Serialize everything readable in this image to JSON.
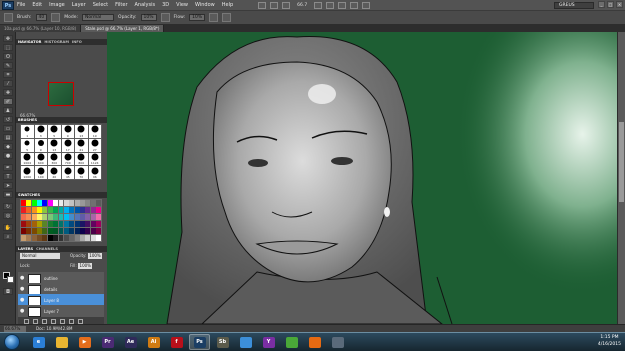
{
  "app": {
    "logo_text": "Ps"
  },
  "menu": {
    "items": [
      "File",
      "Edit",
      "Image",
      "Layer",
      "Select",
      "Filter",
      "Analysis",
      "3D",
      "View",
      "Window",
      "Help"
    ],
    "zoom_readout": "66.7",
    "workspace_label": "GREUS"
  },
  "options_bar": {
    "brush_label": "Brush:",
    "brush_size": "40",
    "mode_label": "Mode:",
    "mode_value": "Normal",
    "opacity_label": "Opacity:",
    "opacity_value": "10%",
    "flow_label": "Flow:",
    "flow_value": "10%"
  },
  "doc_tabs": [
    {
      "label": "10a.psd @ 66.7% (Layer 10, RGB/8)",
      "active": false
    },
    {
      "label": "Stale.psd @ 66.7% (Layer 1, RGB/8*)",
      "active": true
    }
  ],
  "navigator": {
    "tabs": [
      "NAVIGATOR",
      "HISTOGRAM",
      "INFO"
    ],
    "zoom": "66.67%"
  },
  "brushes": {
    "tabs": [
      "BRUSHES"
    ],
    "presets": [
      {
        "size": 5,
        "num": "1"
      },
      {
        "size": 8,
        "num": "3"
      },
      {
        "size": 10,
        "num": "5"
      },
      {
        "size": 12,
        "num": "9"
      },
      {
        "size": 14,
        "num": "13"
      },
      {
        "size": 16,
        "num": "19"
      },
      {
        "size": 5,
        "num": "5"
      },
      {
        "size": 6,
        "num": "9"
      },
      {
        "size": 8,
        "num": "13"
      },
      {
        "size": 10,
        "num": "17"
      },
      {
        "size": 12,
        "num": "21"
      },
      {
        "size": 14,
        "num": "27"
      },
      {
        "size": 10,
        "num": "1004"
      },
      {
        "size": 12,
        "num": "600"
      },
      {
        "size": 14,
        "num": "300"
      },
      {
        "size": 16,
        "num": "700"
      },
      {
        "size": 16,
        "num": "800"
      },
      {
        "size": 18,
        "num": "1124"
      },
      {
        "size": 14,
        "num": "1000"
      },
      {
        "size": 10,
        "num": "100"
      },
      {
        "size": 12,
        "num": "40"
      },
      {
        "size": 16,
        "num": "45"
      },
      {
        "size": 18,
        "num": "70"
      },
      {
        "size": 18,
        "num": "96"
      }
    ]
  },
  "swatches": {
    "tabs": [
      "SWATCHES"
    ],
    "colors": [
      "#ff0000",
      "#ffff00",
      "#00ff00",
      "#00ffff",
      "#0000ff",
      "#ff00ff",
      "#ffffff",
      "#ebebeb",
      "#d6d6d6",
      "#c2c2c2",
      "#adadad",
      "#999999",
      "#858585",
      "#707070",
      "#5c5c5c",
      "#ed1c24",
      "#f26522",
      "#f7941d",
      "#fff200",
      "#8dc63f",
      "#39b54a",
      "#00a651",
      "#00a99d",
      "#00aeef",
      "#0072bc",
      "#0054a6",
      "#2e3192",
      "#662d91",
      "#92278f",
      "#ec008c",
      "#f26c4f",
      "#f68e56",
      "#fbaf5d",
      "#fff568",
      "#acd373",
      "#7cc576",
      "#3cb878",
      "#1cbbb4",
      "#00bff3",
      "#448ccb",
      "#5674b9",
      "#605ca8",
      "#8560a8",
      "#a864a8",
      "#f06eaa",
      "#9e0b0f",
      "#a0410d",
      "#a36209",
      "#aba000",
      "#598527",
      "#197b30",
      "#007236",
      "#00746b",
      "#0076a3",
      "#004a80",
      "#003471",
      "#1b1464",
      "#440e62",
      "#630460",
      "#9e005d",
      "#790000",
      "#7b2e00",
      "#7d4900",
      "#827b00",
      "#406618",
      "#005e20",
      "#005826",
      "#005952",
      "#005b7f",
      "#003663",
      "#002157",
      "#0d004c",
      "#32004b",
      "#4b0049",
      "#7b0046",
      "#c69c6d",
      "#a67c52",
      "#8c6239",
      "#754c24",
      "#603913",
      "#000000",
      "#1a1a1a",
      "#333333",
      "#4d4d4d",
      "#666666",
      "#808080",
      "#aaaaaa",
      "#cccccc",
      "#e0e0e0",
      "#ffffff"
    ]
  },
  "layers": {
    "tabs": [
      "LAYERS",
      "CHANNELS"
    ],
    "mode": "Normal",
    "opacity_label": "Opacity:",
    "opacity": "100%",
    "lock_label": "Lock:",
    "fill_label": "Fill:",
    "fill": "100%",
    "list": [
      {
        "name": "outline",
        "selected": false
      },
      {
        "name": "details",
        "selected": false
      },
      {
        "name": "Layer 8",
        "selected": true
      },
      {
        "name": "Layer 7",
        "selected": false
      }
    ]
  },
  "status": {
    "zoom": "66.67%",
    "doc_size": "Doc: 10.9M/42.8M"
  },
  "taskbar": {
    "apps": [
      {
        "name": "internet-explorer",
        "label": "e",
        "color": "#2b7fd6",
        "active": false
      },
      {
        "name": "explorer",
        "label": "",
        "color": "#e8b531",
        "active": false
      },
      {
        "name": "media-player",
        "label": "▶",
        "color": "#e46d1c",
        "active": false
      },
      {
        "name": "premiere",
        "label": "Pr",
        "color": "#4b2a74",
        "active": false
      },
      {
        "name": "after-effects",
        "label": "Ae",
        "color": "#2f2a5a",
        "active": false
      },
      {
        "name": "illustrator",
        "label": "Ai",
        "color": "#d07b12",
        "active": false
      },
      {
        "name": "flash",
        "label": "f",
        "color": "#b8101a",
        "active": false
      },
      {
        "name": "photoshop",
        "label": "Ps",
        "color": "#1b3e64",
        "active": true
      },
      {
        "name": "soundbooth",
        "label": "Sb",
        "color": "#5b5b4b",
        "active": false
      },
      {
        "name": "clock",
        "label": "",
        "color": "#3c8fd9",
        "active": false
      },
      {
        "name": "yahoo-messenger",
        "label": "Y",
        "color": "#7a2ea3",
        "active": false
      },
      {
        "name": "chrome",
        "label": "",
        "color": "#4aa838",
        "active": false
      },
      {
        "name": "firefox",
        "label": "",
        "color": "#e66a12",
        "active": false
      },
      {
        "name": "desktop-window",
        "label": "",
        "color": "#5a6a7a",
        "active": false
      }
    ],
    "time": "1:15 PM",
    "date": "4/16/2015"
  }
}
